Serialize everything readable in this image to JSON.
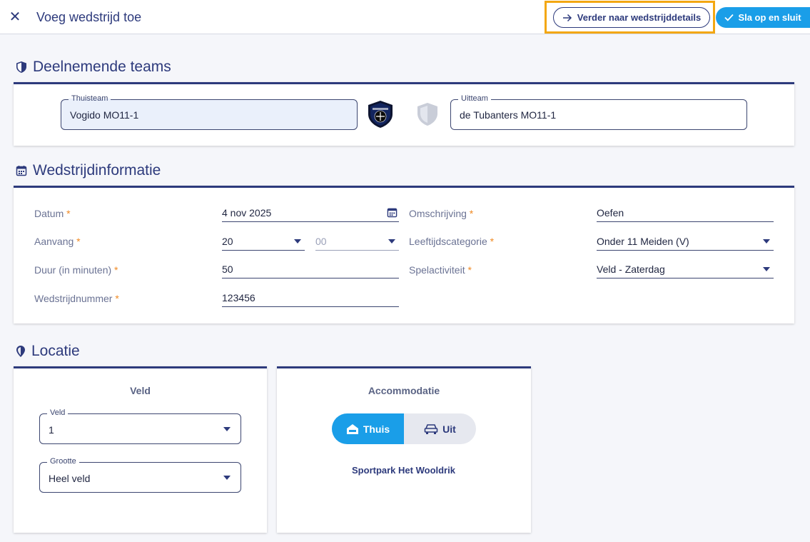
{
  "header": {
    "title": "Voeg wedstrijd toe",
    "next_button": "Verder naar wedstrijddetails",
    "save_button": "Sla op en sluit"
  },
  "teams": {
    "section_title": "Deelnemende teams",
    "home_label": "Thuisteam",
    "home_value": "Vogido MO11-1",
    "away_label": "Uitteam",
    "away_value": "de Tubanters MO11-1"
  },
  "info": {
    "section_title": "Wedstrijdinformatie",
    "datum_label": "Datum",
    "datum_value": "4 nov 2025",
    "aanvang_label": "Aanvang",
    "aanvang_hour": "20",
    "aanvang_minute": "00",
    "duur_label": "Duur (in minuten)",
    "duur_value": "50",
    "nummer_label": "Wedstrijdnummer",
    "nummer_value": "123456",
    "omschrijving_label": "Omschrijving",
    "omschrijving_value": "Oefen",
    "leeftijd_label": "Leeftijdscategorie",
    "leeftijd_value": "Onder 11 Meiden (V)",
    "spel_label": "Spelactiviteit",
    "spel_value": "Veld - Zaterdag",
    "required_mark": "*"
  },
  "location": {
    "section_title": "Locatie",
    "veld_title": "Veld",
    "veld_label": "Veld",
    "veld_value": "1",
    "grootte_label": "Grootte",
    "grootte_value": "Heel veld",
    "accommodatie_title": "Accommodatie",
    "thuis_label": "Thuis",
    "uit_label": "Uit",
    "venue": "Sportpark Het Wooldrik"
  },
  "colors": {
    "primary": "#2d3a7c",
    "accent": "#1a9ee8",
    "highlight": "#f3a712",
    "required": "#f08a24"
  }
}
